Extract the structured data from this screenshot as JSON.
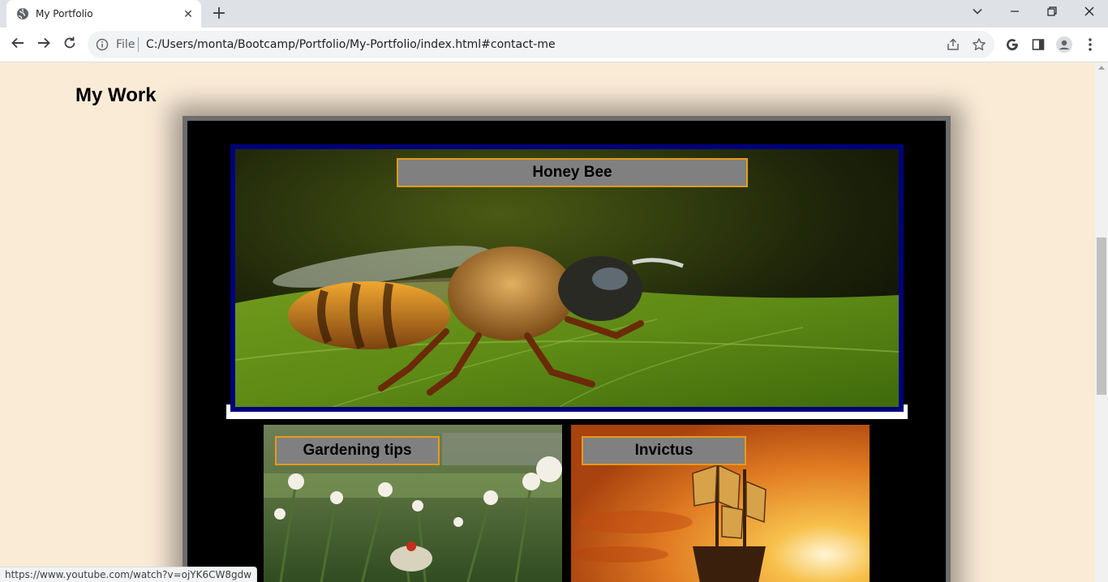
{
  "browser": {
    "tab_title": "My Portfolio",
    "tab_icon": "globe-icon",
    "url_scheme": "File",
    "url": "C:/Users/monta/Bootcamp/Portfolio/My-Portfolio/index.html#contact-me",
    "status_url": "https://www.youtube.com/watch?v=ojYK6CW8gdw"
  },
  "page": {
    "section_title": "My Work",
    "featured": {
      "label": "Honey Bee"
    },
    "projects": [
      {
        "label": "Gardening tips"
      },
      {
        "label": "Invictus"
      }
    ]
  },
  "colors": {
    "page_background": "#faebd7",
    "frame_background": "#000000",
    "featured_border": "#00007a",
    "label_background": "#808080",
    "label_border": "#e69a1a"
  }
}
